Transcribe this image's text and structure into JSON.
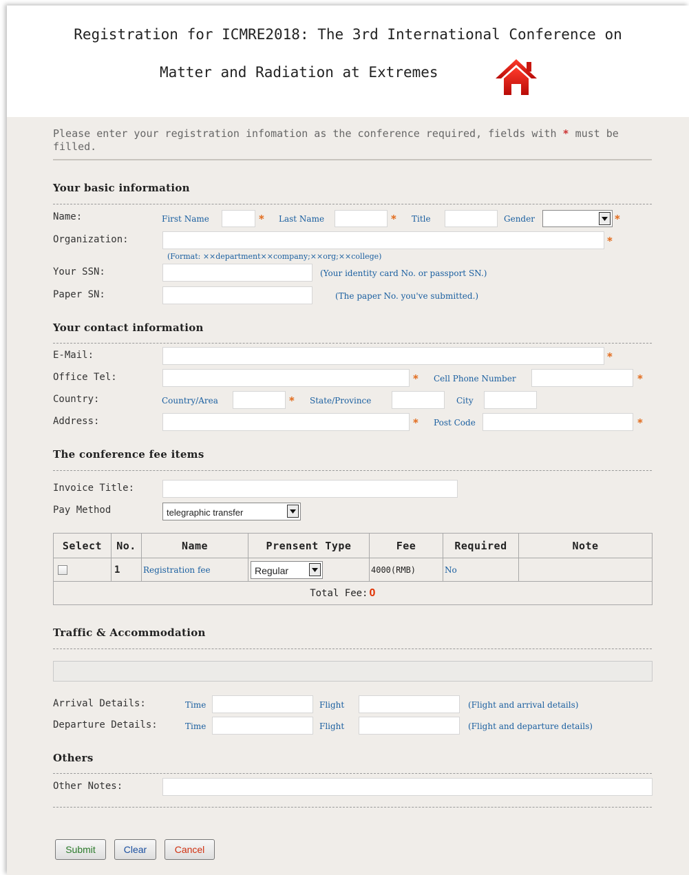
{
  "page": {
    "title_line1": "Registration for ICMRE2018: The 3rd International Conference on",
    "title_line2": "Matter and Radiation at Extremes",
    "intro_text": "Please enter your registration infomation as the conference required, fields with",
    "intro_req_mark": "*",
    "intro_tail": "must be filled."
  },
  "basic": {
    "heading": "Your basic information",
    "name_label": "Name:",
    "first_name_label": "First Name",
    "last_name_label": "Last Name",
    "title_label": "Title",
    "gender_label": "Gender",
    "gender_value": "",
    "organization_label": "Organization:",
    "organization_hint": "(Format: ××department××company;××org;××college)",
    "ssn_label": "Your SSN:",
    "ssn_hint": "(Your identity card No. or passport SN.)",
    "paper_label": "Paper SN:",
    "paper_hint": "(The paper No. you've submitted.)"
  },
  "contact": {
    "heading": "Your contact information",
    "email_label": "E-Mail:",
    "office_tel_label": "Office Tel:",
    "cell_label": "Cell Phone Number",
    "country_label": "Country:",
    "country_area_label": "Country/Area",
    "state_label": "State/Province",
    "city_label": "City",
    "address_label": "Address:",
    "post_code_label": "Post Code"
  },
  "fees": {
    "heading": "The conference fee items",
    "invoice_label": "Invoice Title:",
    "pay_method_label": "Pay Method",
    "pay_method_value": "telegraphic transfer",
    "columns": [
      "Select",
      "No.",
      "Name",
      "Prensent Type",
      "Fee",
      "Required",
      "Note"
    ],
    "rows": [
      {
        "no": "1",
        "name": "Registration fee",
        "type": "Regular",
        "fee": "4000(RMB)",
        "required": "No",
        "note": "",
        "checked": false
      }
    ],
    "total_label": "Total Fee:",
    "total_value": "0"
  },
  "traffic": {
    "heading": "Traffic & Accommodation",
    "arrival_label": "Arrival Details:",
    "departure_label": "Departure Details:",
    "time_label": "Time",
    "flight_label": "Flight",
    "arrival_hint": "(Flight and arrival details)",
    "departure_hint": "(Flight and departure details)"
  },
  "others": {
    "heading": "Others",
    "notes_label": "Other Notes:"
  },
  "buttons": {
    "submit": "Submit",
    "clear": "Clear",
    "cancel": "Cancel"
  },
  "required_mark": "*",
  "colors": {
    "form_bg": "#f0ede9",
    "hint_blue": "#1a5fa0",
    "required_orange": "#e05a00",
    "total_red": "#e03000",
    "submit_text": "#2a7a2a",
    "clear_text": "#1a4fa0",
    "cancel_text": "#d03010"
  },
  "icons": [
    "home-icon",
    "chevron-down-icon"
  ]
}
